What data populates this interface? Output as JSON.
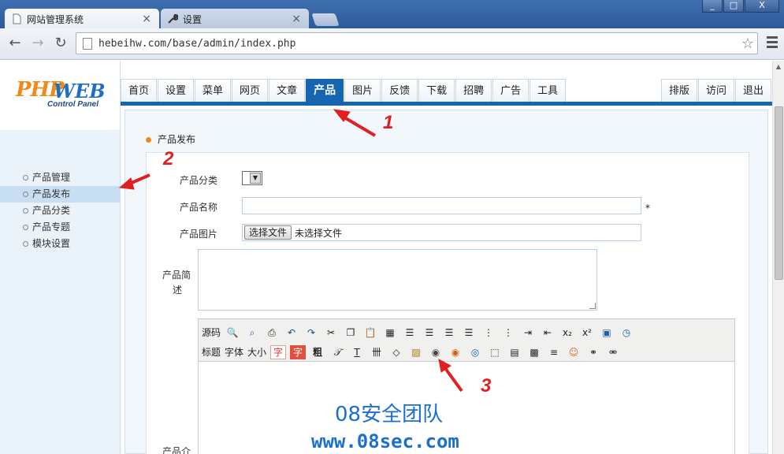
{
  "browser": {
    "tabs": [
      {
        "label": "网站管理系统",
        "icon": "page-icon"
      },
      {
        "label": "设置",
        "icon": "wrench-icon"
      }
    ],
    "url": "hebeihw.com/base/admin/index.php",
    "window_buttons": [
      "_",
      "□",
      "X"
    ]
  },
  "logo": {
    "word1": "PHP",
    "word2": "WEB",
    "subtitle": "Control Panel"
  },
  "nav": {
    "tabs": [
      "首页",
      "设置",
      "菜单",
      "网页",
      "文章",
      "产品",
      "图片",
      "反馈",
      "下载",
      "招聘",
      "广告",
      "工具"
    ],
    "active": "产品",
    "right_tabs": [
      "排版",
      "访问",
      "退出"
    ]
  },
  "sidebar": {
    "items": [
      "产品管理",
      "产品发布",
      "产品分类",
      "产品专题",
      "模块设置"
    ],
    "active": "产品发布"
  },
  "form": {
    "section_title": "产品发布",
    "category_label": "产品分类",
    "name_label": "产品名称",
    "required_mark": "*",
    "image_label": "产品图片",
    "file_button": "选择文件",
    "file_status": "未选择文件",
    "summary_label_1": "产品简",
    "summary_label_2": "述",
    "detail_label": "产品介"
  },
  "editor": {
    "row1": [
      "源码",
      "preview-icon",
      "search-icon",
      "print-icon",
      "undo-icon",
      "redo-icon",
      "cut-icon",
      "copy-icon",
      "paste-icon",
      "table-grid-icon",
      "align-left-icon",
      "align-center-icon",
      "align-right-icon",
      "justify-icon",
      "ordered-list-icon",
      "unordered-list-icon",
      "indent-icon",
      "outdent-icon",
      "subscript-icon",
      "superscript-icon",
      "date-icon",
      "time-icon"
    ],
    "row2_text": [
      "标题",
      "字体",
      "大小",
      "字",
      "字",
      "粗"
    ],
    "row2_icons": [
      "italic-icon",
      "underline-icon",
      "strike-icon",
      "eraser-icon",
      "image-icon",
      "flash-icon",
      "media-icon",
      "realplayer-icon",
      "layer-icon",
      "table-icon",
      "special-char-icon",
      "hr-icon",
      "emoticon-icon",
      "link-icon",
      "unlink-icon"
    ]
  },
  "annotations": {
    "n1": "1",
    "n2": "2",
    "n3": "3"
  },
  "watermark": {
    "title": "08安全团队",
    "url": "www.08sec.com"
  },
  "colors": {
    "nav_active": "#1565b0",
    "annotation": "#e02020",
    "watermark": "#1a6fd0",
    "logo_orange": "#f08a1c"
  }
}
